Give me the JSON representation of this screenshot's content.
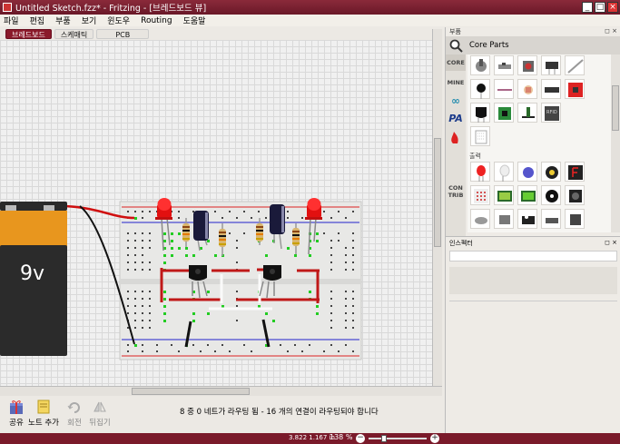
{
  "window": {
    "title": "Untitled Sketch.fzz* - Fritzing - [브레드보드 뷰]",
    "buttons": [
      "_",
      "□",
      "×"
    ]
  },
  "menu": {
    "items": [
      "파일",
      "편집",
      "부품",
      "보기",
      "윈도우",
      "Routing",
      "도움말"
    ]
  },
  "view_tabs": {
    "items": [
      "브레드보드",
      "스케매틱",
      "PCB"
    ],
    "active_index": 0
  },
  "breadboard": {
    "battery_label": "9v"
  },
  "toolbar": {
    "share_label": "공유",
    "add_note_label": "노트 추가",
    "rotate_label": "회전",
    "flip_label": "뒤집기"
  },
  "status": {
    "routing_message": "8 중 0 네트가 라우팅 됨 - 16 개의 연결이 라우팅되야 합니다",
    "coordinates": "3.822 1.167 in",
    "zoom": "138 %",
    "zoom_minus": "−",
    "zoom_plus": "+"
  },
  "parts_panel": {
    "header": "부품",
    "header_buttons": "◻ ×",
    "bin_title": "Core Parts",
    "bins": [
      "CORE",
      "MINE",
      "∞",
      "PA",
      "",
      "",
      "",
      "CON TRIB"
    ],
    "category_label": "출력"
  },
  "inspector": {
    "header": "인스펙터",
    "header_buttons": "◻ ×"
  },
  "colors": {
    "accent": "#8a1a2a",
    "canvas": "#f0f0f0",
    "wire_red": "#d01010",
    "wire_black": "#111111"
  }
}
